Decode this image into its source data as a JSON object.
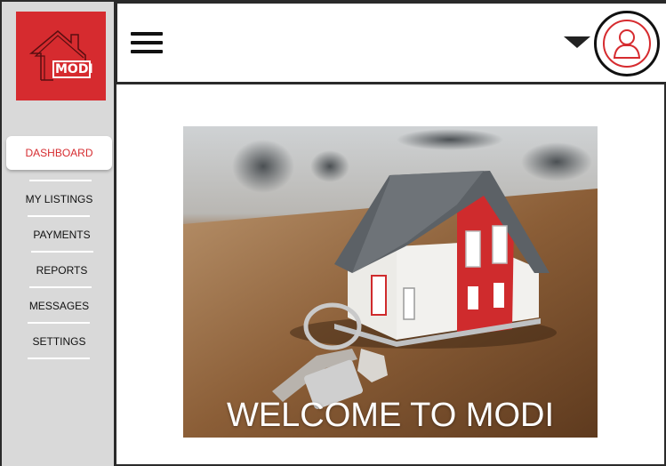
{
  "app": {
    "logo_text": "MODI",
    "brand_color": "#d62b2f"
  },
  "sidebar": {
    "items": [
      {
        "label": "DASHBOARD",
        "active": true
      },
      {
        "label": "MY LISTINGS",
        "active": false
      },
      {
        "label": "PAYMENTS",
        "active": false
      },
      {
        "label": "REPORTS",
        "active": false
      },
      {
        "label": "MESSAGES",
        "active": false
      },
      {
        "label": "SETTINGS",
        "active": false
      }
    ]
  },
  "header": {
    "menu_icon": "hamburger-menu-icon",
    "dropdown_icon": "caret-down-icon",
    "avatar_icon": "user-avatar-icon"
  },
  "hero": {
    "image": "house-model-with-keys-photo",
    "welcome_text": "WELCOME TO MODI"
  }
}
